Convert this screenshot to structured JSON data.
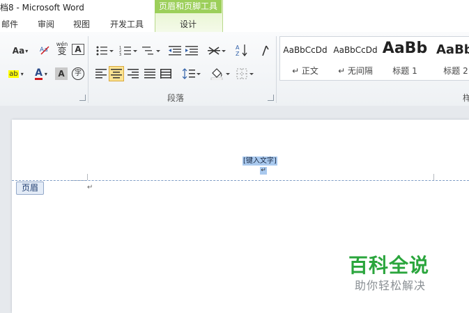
{
  "window": {
    "title": "档8 - Microsoft Word"
  },
  "context_tab": {
    "group_title": "页眉和页脚工具",
    "tab_label": "设计"
  },
  "tabs": [
    {
      "label": "邮件"
    },
    {
      "label": "审阅"
    },
    {
      "label": "视图"
    },
    {
      "label": "开发工具"
    }
  ],
  "ribbon": {
    "font_group": {
      "change_case": "Aa",
      "highlight_label": "ab",
      "font_color_label": "A",
      "char_shading_label": "A",
      "enclose_label": "字",
      "phonetic_top": "wén",
      "phonetic_main": "变",
      "border_label": "A"
    },
    "paragraph_group": {
      "label": "段落"
    },
    "styles": [
      {
        "sample": "AaBbCcDd",
        "name": "↵ 正文"
      },
      {
        "sample": "AaBbCcDd",
        "name": "↵ 无间隔"
      },
      {
        "sample": "AaBb",
        "name": "标题 1"
      },
      {
        "sample": "AaBb",
        "name": "标题 2"
      }
    ],
    "styles_group_label": "样"
  },
  "document": {
    "header_placeholder": "[键入文字]",
    "paragraph_mark": "↵",
    "header_label": "页眉"
  },
  "watermark": {
    "title": "百科全说",
    "subtitle": "助你轻松解决"
  },
  "colors": {
    "context_green": "#9ccf5a",
    "highlight_yellow": "#ffff00",
    "font_red": "#d0191d",
    "selection_blue": "#a9c9ee",
    "watermark_green": "#2aa53c"
  }
}
